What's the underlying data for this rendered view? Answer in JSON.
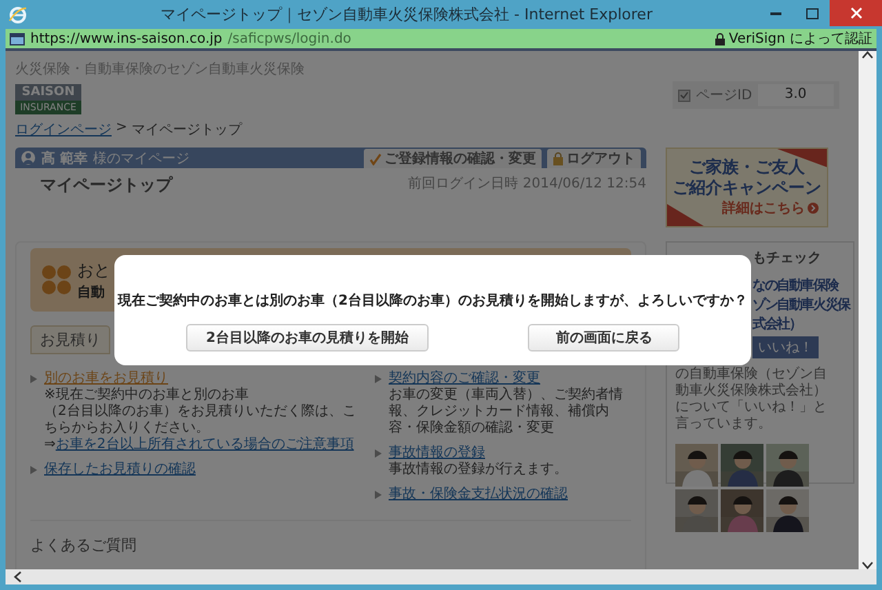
{
  "window": {
    "title": "マイページトップ｜セゾン自動車火災保険株式会社 - Internet Explorer"
  },
  "address_bar": {
    "url_host": "https://www.ins-saison.co.jp",
    "url_path": "/saficpws/login.do",
    "certificate": "VeriSign によって認証"
  },
  "page": {
    "tagline": "火災保険・自動車保険のセゾン自動車火災保険",
    "logo": [
      "SAISON",
      "INSURANCE"
    ],
    "page_id": {
      "label": "ページID",
      "value": "3.0"
    },
    "breadcrumb": {
      "link": "ログインページ",
      "separator": ">",
      "current": "マイページトップ"
    },
    "user_bar": {
      "name": "髙 範幸",
      "suffix": "様のマイページ",
      "tabs": [
        {
          "kind": "check",
          "label": "ご登録情報の確認・変更"
        },
        {
          "kind": "lock",
          "label": "ログアウト"
        }
      ]
    },
    "heading": "マイページトップ",
    "last_login": "前回ログイン日時 2014/06/12 12:54",
    "promo": [
      "おと",
      "自動"
    ],
    "estimate_tab": "お見積り",
    "menu_left": [
      {
        "link": "別のお車をお見積り",
        "visited": true,
        "lines": [
          "※現在ご契約中のお車と別のお車",
          "（2台目以降のお車）をお見積りいただく際は、こちらからお入りください。"
        ],
        "sublink_arrow": "⇒",
        "sublink": "お車を2台以上所有されている場合のご注意事項"
      },
      {
        "link": "保存したお見積りの確認",
        "visited": false
      }
    ],
    "menu_right": [
      {
        "link": "契約内容のご確認・変更",
        "visited": false,
        "lines": [
          "お車の変更（車両入替）、ご契約者情報、クレジットカード情報、補償内容・保険金額の確認・変更"
        ]
      },
      {
        "link": "事故情報の登録",
        "visited": false,
        "lines": [
          "事故情報の登録が行えます。"
        ]
      },
      {
        "link": "事故・保険金支払状況の確認",
        "visited": false
      }
    ],
    "faq_title": "よくあるご質問",
    "campaign": {
      "lines": [
        "ご家族・ご友人",
        "ご紹介キャンペーン"
      ],
      "link": "詳細はこちら"
    },
    "facebook": {
      "title": "もチェック",
      "page_name": [
        "なの自動車保険",
        "ゾン自動車火災保",
        "式会社）"
      ],
      "like": "いいね！",
      "text": "の自動車保険（セゾン自動車火災保険株式会社）について「いいね！」と言っています。"
    }
  },
  "dialog": {
    "message": "現在ご契約中のお車とは別のお車（2台目以降のお車）のお見積りを開始しますが、よろしいですか？",
    "buttons": [
      "2台目以降のお車の見積りを開始",
      "前の画面に戻る"
    ]
  }
}
